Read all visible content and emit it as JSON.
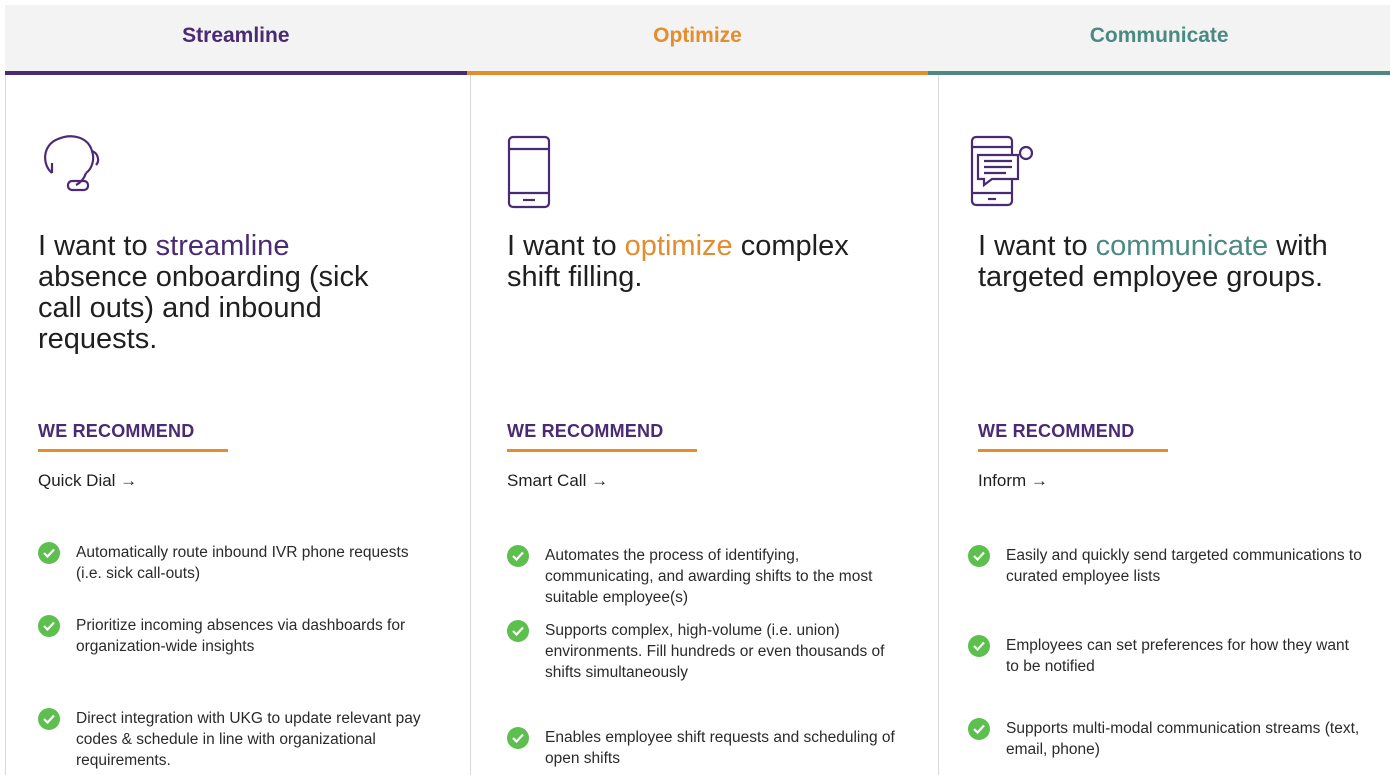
{
  "tabs": [
    {
      "label": "Streamline"
    },
    {
      "label": "Optimize"
    },
    {
      "label": "Communicate"
    }
  ],
  "columns": [
    {
      "icon": "headset-icon",
      "headline_prefix": "I want to ",
      "headline_highlight": "streamline",
      "headline_suffix": " absence onboarding (sick call outs) and inbound requests.",
      "rec_label": "WE RECOMMEND",
      "product": "Quick Dial →",
      "features": [
        "Automatically route inbound IVR phone requests (i.e. sick call-outs)",
        "Prioritize incoming absences via dashboards for organization-wide insights",
        "Direct integration with UKG to update relevant pay codes & schedule in line with organizational requirements."
      ]
    },
    {
      "icon": "smartphone-icon",
      "headline_prefix": "I want to ",
      "headline_highlight": "optimize",
      "headline_suffix": " complex shift filling.",
      "rec_label": "WE RECOMMEND",
      "product": "Smart Call →",
      "features": [
        "Automates the process of identifying, communicating, and awarding shifts to the most suitable employee(s)",
        "Supports complex, high-volume (i.e. union) environments. Fill hundreds or even thousands of shifts simultaneously",
        "Enables employee shift requests and scheduling of open shifts"
      ]
    },
    {
      "icon": "mobile-message-icon",
      "headline_prefix": "I want to ",
      "headline_highlight": "communicate",
      "headline_suffix": " with targeted employee groups.",
      "rec_label": "WE RECOMMEND",
      "product": "Inform →",
      "features": [
        "Easily and quickly send targeted communications to curated employee lists",
        "Employees can set preferences for how they want to be notified",
        "Supports multi-modal communication streams (text, email, phone)"
      ]
    }
  ]
}
